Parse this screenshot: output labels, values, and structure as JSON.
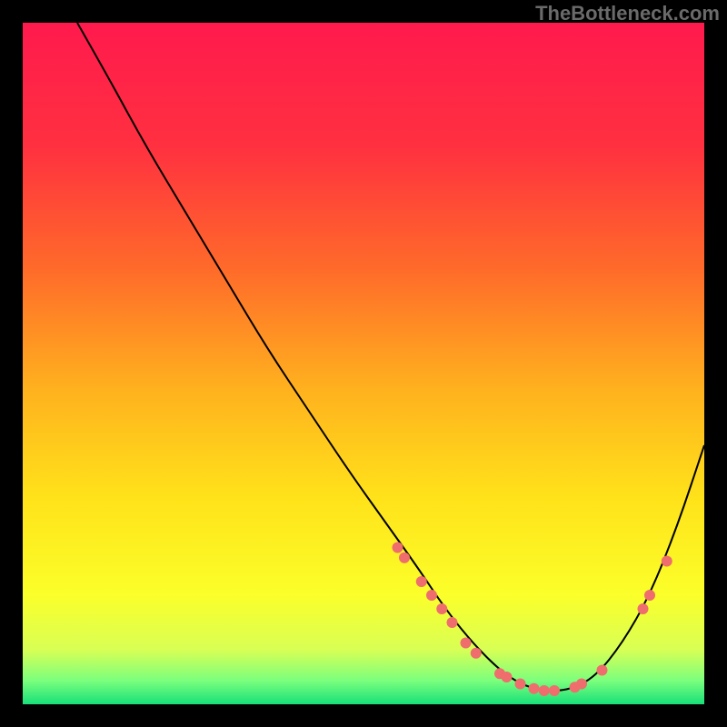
{
  "watermark": "TheBottleneck.com",
  "chart_data": {
    "type": "line",
    "title": "",
    "xlabel": "",
    "ylabel": "",
    "xlim": [
      0,
      100
    ],
    "ylim": [
      0,
      100
    ],
    "grid": false,
    "legend": false,
    "background": {
      "type": "vertical-gradient",
      "stops": [
        {
          "offset": 0.0,
          "color": "#ff1a4d"
        },
        {
          "offset": 0.18,
          "color": "#ff3040"
        },
        {
          "offset": 0.36,
          "color": "#ff6a2a"
        },
        {
          "offset": 0.54,
          "color": "#ffb21e"
        },
        {
          "offset": 0.7,
          "color": "#ffe31a"
        },
        {
          "offset": 0.84,
          "color": "#fbff2a"
        },
        {
          "offset": 0.92,
          "color": "#d8ff55"
        },
        {
          "offset": 0.965,
          "color": "#7cff7c"
        },
        {
          "offset": 1.0,
          "color": "#18e07a"
        }
      ]
    },
    "series": [
      {
        "name": "bottleneck-curve",
        "color": "#000000",
        "x": [
          8,
          12,
          18,
          24,
          30,
          36,
          42,
          48,
          53,
          58,
          62,
          66,
          70,
          73,
          76,
          80,
          84,
          88,
          92,
          96,
          100
        ],
        "y": [
          100,
          93,
          82,
          72,
          62,
          52,
          43,
          34,
          27,
          20,
          14,
          9,
          5,
          3,
          2,
          2,
          4,
          9,
          16,
          26,
          38
        ]
      }
    ],
    "points": {
      "name": "highlight-dots",
      "color": "#ef6d6d",
      "radius": 6,
      "data": [
        {
          "x": 55,
          "y": 23
        },
        {
          "x": 56,
          "y": 21.5
        },
        {
          "x": 58.5,
          "y": 18
        },
        {
          "x": 60,
          "y": 16
        },
        {
          "x": 61.5,
          "y": 14
        },
        {
          "x": 63,
          "y": 12
        },
        {
          "x": 65,
          "y": 9
        },
        {
          "x": 66.5,
          "y": 7.5
        },
        {
          "x": 70,
          "y": 4.5
        },
        {
          "x": 71,
          "y": 4
        },
        {
          "x": 73,
          "y": 3
        },
        {
          "x": 75,
          "y": 2.3
        },
        {
          "x": 76.5,
          "y": 2
        },
        {
          "x": 78,
          "y": 2
        },
        {
          "x": 81,
          "y": 2.5
        },
        {
          "x": 82,
          "y": 3
        },
        {
          "x": 85,
          "y": 5
        },
        {
          "x": 91,
          "y": 14
        },
        {
          "x": 92,
          "y": 16
        },
        {
          "x": 94.5,
          "y": 21
        }
      ]
    }
  }
}
